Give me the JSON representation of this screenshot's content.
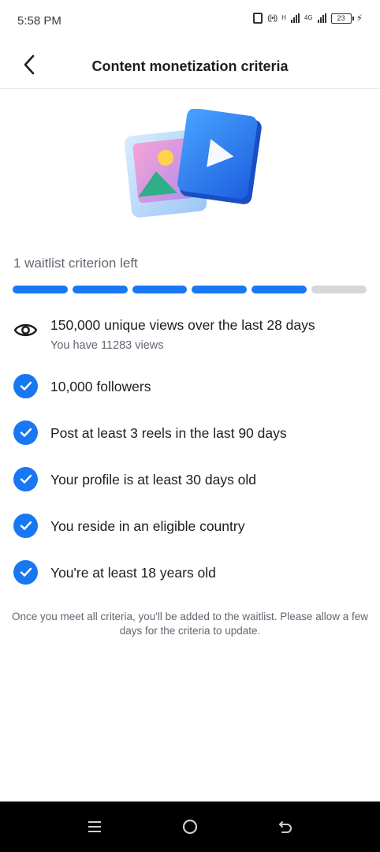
{
  "status_bar": {
    "time": "5:58 PM",
    "network_h": "H",
    "network_4g": "4G",
    "battery": "23"
  },
  "header": {
    "title": "Content monetization criteria"
  },
  "progress": {
    "waitlist_text": "1 waitlist criterion left",
    "completed_segments": 5,
    "total_segments": 6,
    "done_color": "#1877f2",
    "pending_color": "#d5d7da"
  },
  "criteria": [
    {
      "icon": "eye-icon",
      "title": "150,000 unique views over the last 28 days",
      "subtitle": "You have 11283 views",
      "met": false
    },
    {
      "icon": "check-icon",
      "title": "10,000 followers",
      "met": true
    },
    {
      "icon": "check-icon",
      "title": "Post at least 3 reels in the last 90 days",
      "met": true
    },
    {
      "icon": "check-icon",
      "title": "Your profile is at least 30 days old",
      "met": true
    },
    {
      "icon": "check-icon",
      "title": "You reside in an eligible country",
      "met": true
    },
    {
      "icon": "check-icon",
      "title": "You're at least 18 years old",
      "met": true
    }
  ],
  "footnote": "Once you meet all criteria, you'll be added to the waitlist. Please allow a few days for the criteria to update.",
  "nav": {
    "icons": [
      "menu-icon",
      "home-icon",
      "back-icon"
    ]
  },
  "colors": {
    "accent": "#1877f2"
  }
}
